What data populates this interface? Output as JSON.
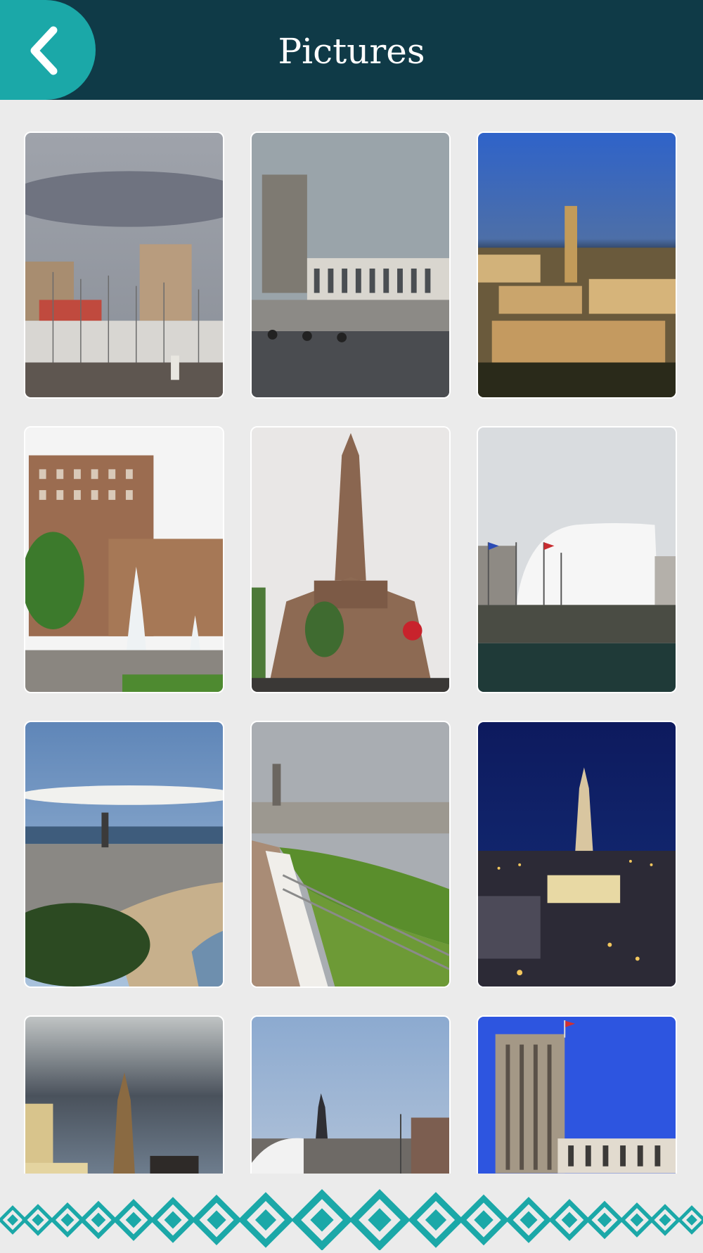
{
  "header": {
    "title": "Pictures",
    "back_icon": "chevron-left-icon",
    "background": "#0f3a47",
    "accent": "#1ba8a8"
  },
  "gallery": {
    "photos": [
      {
        "name": "photo-marina"
      },
      {
        "name": "photo-town-hall-square"
      },
      {
        "name": "photo-city-sunset-aerial"
      },
      {
        "name": "photo-fountain-buildings"
      },
      {
        "name": "photo-church-tower"
      },
      {
        "name": "photo-volcano-white-building"
      },
      {
        "name": "photo-beach-panorama"
      },
      {
        "name": "photo-promenade-lawn"
      },
      {
        "name": "photo-city-night"
      },
      {
        "name": "photo-tower-cloudy-sky"
      },
      {
        "name": "photo-skyline-distance"
      },
      {
        "name": "photo-town-hall-tower"
      }
    ]
  },
  "footer": {
    "pattern_icon": "diamond-pattern",
    "color": "#1ba8a8"
  }
}
